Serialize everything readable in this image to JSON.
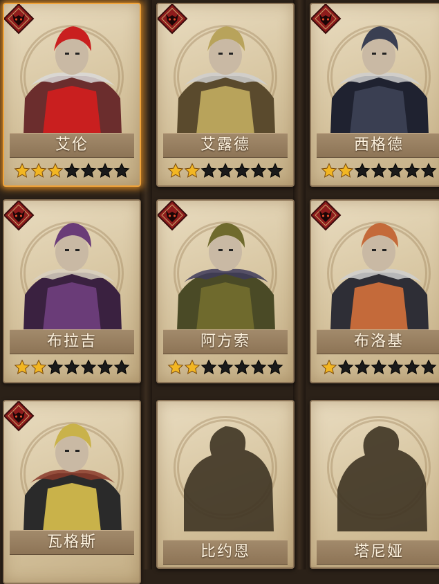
{
  "colors": {
    "star_filled": "#f2b623",
    "star_empty": "#1a1a1a",
    "badge_red": "#8e1c1c",
    "selected_glow": "#f0a33a"
  },
  "heroes": [
    {
      "name": "艾伦",
      "stars": 3,
      "max_stars": 7,
      "selected": true,
      "locked": false,
      "palette": [
        "#6b2d2d",
        "#c91f1f",
        "#d9d9d9"
      ]
    },
    {
      "name": "艾露德",
      "stars": 2,
      "max_stars": 7,
      "selected": false,
      "locked": false,
      "palette": [
        "#5a4a2d",
        "#b8a35b",
        "#cfcfcf"
      ]
    },
    {
      "name": "西格德",
      "stars": 2,
      "max_stars": 7,
      "selected": false,
      "locked": false,
      "palette": [
        "#1f2230",
        "#3a3f52",
        "#cfcfcf"
      ]
    },
    {
      "name": "布拉吉",
      "stars": 2,
      "max_stars": 7,
      "selected": false,
      "locked": false,
      "palette": [
        "#3a2140",
        "#6a3c78",
        "#d8d0c0"
      ]
    },
    {
      "name": "阿方索",
      "stars": 2,
      "max_stars": 7,
      "selected": false,
      "locked": false,
      "palette": [
        "#4a4a26",
        "#6f6a2d",
        "#3d3a5a"
      ]
    },
    {
      "name": "布洛基",
      "stars": 1,
      "max_stars": 7,
      "selected": false,
      "locked": false,
      "palette": [
        "#2e2e36",
        "#c46a3a",
        "#cfcfcf"
      ]
    },
    {
      "name": "瓦格斯",
      "stars": null,
      "max_stars": 7,
      "selected": false,
      "locked": false,
      "palette": [
        "#2a2a2a",
        "#c9b24a",
        "#8a3a2a"
      ]
    },
    {
      "name": "比约恩",
      "stars": null,
      "max_stars": 7,
      "selected": false,
      "locked": true,
      "palette": [
        "#3e3424",
        "#3e3424",
        "#3e3424"
      ]
    },
    {
      "name": "塔尼娅",
      "stars": null,
      "max_stars": 7,
      "selected": false,
      "locked": true,
      "palette": [
        "#3e3424",
        "#3e3424",
        "#3e3424"
      ]
    }
  ]
}
